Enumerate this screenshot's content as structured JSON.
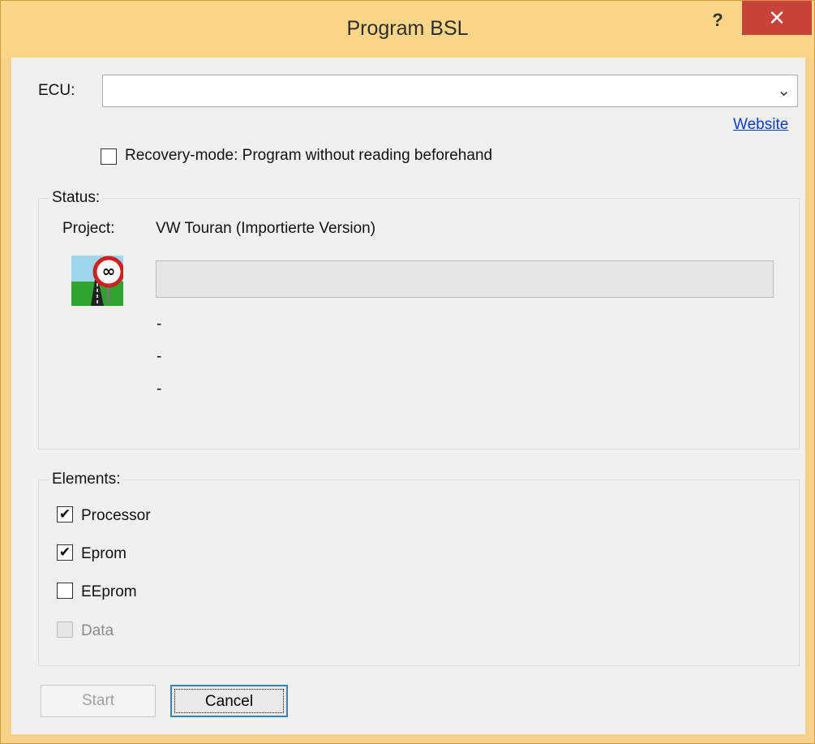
{
  "window": {
    "title": "Program BSL",
    "help_label": "?",
    "close_label": "✕"
  },
  "ecu": {
    "label": "ECU:",
    "value": "",
    "arrow": "⌄",
    "website_link": "Website"
  },
  "recovery": {
    "label": "Recovery-mode: Program without reading beforehand",
    "checked": false
  },
  "status": {
    "group_label": "Status:",
    "project_label": "Project:",
    "project_value": "VW Touran (Importierte Version)",
    "progress_percent": 0,
    "lines": [
      "-",
      "-",
      "-"
    ]
  },
  "elements": {
    "group_label": "Elements:",
    "items": [
      {
        "label": "Processor",
        "checked": true,
        "enabled": true
      },
      {
        "label": "Eprom",
        "checked": true,
        "enabled": true
      },
      {
        "label": "EEprom",
        "checked": false,
        "enabled": true
      },
      {
        "label": "Data",
        "checked": false,
        "enabled": false
      }
    ]
  },
  "buttons": {
    "start_label": "Start",
    "cancel_label": "Cancel"
  },
  "colors": {
    "title_bar": "#fbd689",
    "close_button": "#c7433a",
    "link": "#0a3bcc",
    "focus_border": "#3c7fb1"
  },
  "icons": {
    "app_icon": "infinity-road-sign-icon",
    "close": "close-icon",
    "help": "help-icon",
    "dropdown": "chevron-down-icon",
    "check": "check-icon"
  }
}
